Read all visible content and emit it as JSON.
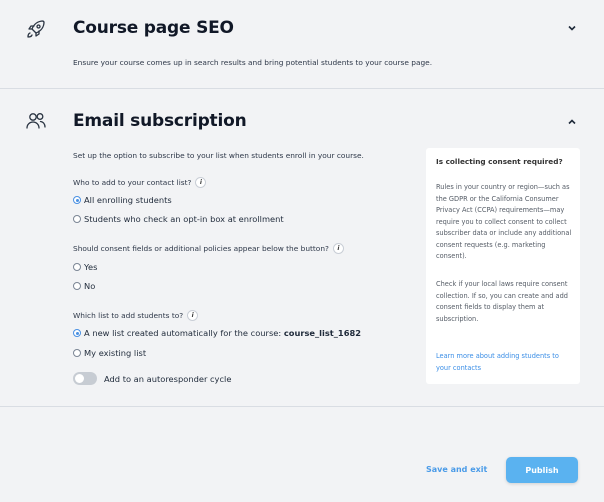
{
  "seo": {
    "title": "Course page SEO",
    "description": "Ensure your course comes up in search results and bring potential students to your course page.",
    "icon": "rocket-icon",
    "state": "collapsed"
  },
  "email": {
    "title": "Email subscription",
    "description": "Set up the option to subscribe to your list when students enroll in your course.",
    "icon": "people-icon",
    "state": "expanded",
    "q1": {
      "label": "Who to add to your contact list?",
      "options": [
        "All enrolling students",
        "Students who check an opt-in box at enrollment"
      ],
      "selected": 0
    },
    "q2": {
      "label": "Should consent fields or additional policies appear below the button?",
      "options": [
        "Yes",
        "No"
      ],
      "selected": -1
    },
    "q3": {
      "label": "Which list to add students to?",
      "option1_prefix": "A new list created automatically for the course: ",
      "option1_list": "course_list_1682",
      "option2": "My existing list",
      "selected": 0
    },
    "autoresponder": {
      "label": "Add to an autoresponder cycle",
      "on": false
    },
    "tip": {
      "title": "Is collecting consent required?",
      "p1": "Rules in your country or region—such as the GDPR or the California Consumer Privacy Act (CCPA) requirements—may require you to collect consent to collect subscriber data or include any additional consent requests (e.g. marketing consent).",
      "p2": "Check if your local laws require consent collection. If so, you can create and add consent fields to display them at subscription.",
      "link": "Learn more about adding students to your contacts"
    }
  },
  "footer": {
    "save_label": "Save and exit",
    "publish_label": "Publish"
  },
  "colors": {
    "accent": "#4a90e2",
    "publish_bg": "#5ab2f0"
  }
}
